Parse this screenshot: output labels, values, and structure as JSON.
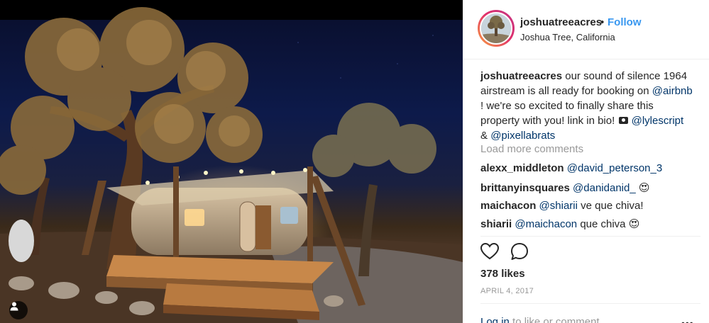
{
  "post": {
    "username": "joshuatreeacres",
    "dot": "•",
    "follow_label": "Follow",
    "location": "Joshua Tree, California"
  },
  "caption": {
    "username": "joshuatreeacres",
    "text_part1": "our sound of silence 1964 airstream is all ready for booking on",
    "mention1": "@airbnb",
    "text_part2": "! we're so excited to finally share this property with you! link in bio!",
    "mention2": "@lylescript",
    "amp": "&",
    "mention3": "@pixellabrats"
  },
  "load_more_label": "Load more comments",
  "comments": [
    {
      "user": "alexx_middleton",
      "mention": "@david_peterson_3",
      "text": ""
    },
    {
      "user": "brittanyinsquares",
      "mention": "@danidanid_",
      "text": "😍"
    },
    {
      "user": "maichacon",
      "mention": "@shiarii",
      "text": "ve que chiva!"
    },
    {
      "user": "shiarii",
      "mention": "@maichacon",
      "text": "que chiva 😍"
    }
  ],
  "likes_text": "378 likes",
  "date_text": "APRIL 4, 2017",
  "login": {
    "link_text": "Log in",
    "rest_text": "to like or comment."
  },
  "more_options_label": "•••",
  "icons": [
    "user-tag-icon",
    "heart-icon",
    "comment-icon",
    "camera-icon",
    "more-options-icon"
  ],
  "colors": {
    "accent": "#3897f0",
    "mention": "#003569",
    "muted": "#999999",
    "text": "#262626"
  }
}
